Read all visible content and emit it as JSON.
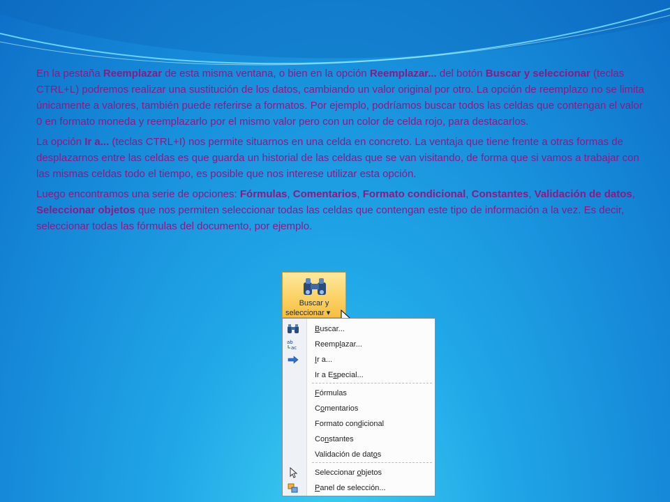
{
  "paragraphs": [
    [
      {
        "t": "En la pestaña ",
        "b": false
      },
      {
        "t": "Reemplazar",
        "b": true
      },
      {
        "t": " de esta misma ventana, o bien en la opción ",
        "b": false
      },
      {
        "t": "Reemplazar...",
        "b": true
      },
      {
        "t": " del botón ",
        "b": false
      },
      {
        "t": "Buscar y seleccionar",
        "b": true
      },
      {
        "t": " (teclas CTRL+L) podremos realizar una sustitución de los datos, cambiando un valor original por otro. La opción de reemplazo no se limita únicamente a valores, también puede referirse a formatos. Por ejemplo, podríamos buscar todos las celdas que contengan el valor 0 en formato moneda y reemplazarlo por el mismo valor pero con un color de celda rojo, para destacarlos.",
        "b": false
      }
    ],
    [
      {
        "t": " La opción ",
        "b": false
      },
      {
        "t": "Ir a...",
        "b": true
      },
      {
        "t": " (teclas CTRL+I) nos permite situarnos en una celda en concreto. La ventaja que tiene frente a otras formas de desplazarnos entre las celdas es que guarda un historial de las celdas que se van visitando, de forma que si vamos a trabajar con las mismas celdas todo el tiempo, es posible que nos interese utilizar esta opción.",
        "b": false
      }
    ],
    [
      {
        "t": " Luego encontramos una serie de opciones: ",
        "b": false
      },
      {
        "t": "Fórmulas",
        "b": true
      },
      {
        "t": ", ",
        "b": false
      },
      {
        "t": "Comentarios",
        "b": true
      },
      {
        "t": ", ",
        "b": false
      },
      {
        "t": "Formato condicional",
        "b": true
      },
      {
        "t": ", ",
        "b": false
      },
      {
        "t": "Constantes",
        "b": true
      },
      {
        "t": ", ",
        "b": false
      },
      {
        "t": "Validación de datos",
        "b": true
      },
      {
        "t": ", ",
        "b": false
      },
      {
        "t": "Seleccionar objetos",
        "b": true
      },
      {
        "t": " que nos permiten seleccionar todas las celdas que contengan este tipo de información a la vez. Es decir, seleccionar todas las fórmulas del documento, por ejemplo.",
        "b": false
      }
    ]
  ],
  "ribbon_button": {
    "line1": "Buscar y",
    "line2": "seleccionar",
    "icon": "binoculars-icon"
  },
  "menu": {
    "items": [
      {
        "pre": "",
        "u": "B",
        "post": "uscar...",
        "icon": "binoculars-icon",
        "name": "menu-item-buscar"
      },
      {
        "pre": "Reemp",
        "u": "l",
        "post": "azar...",
        "icon": "replace-icon",
        "name": "menu-item-reemplazar"
      },
      {
        "pre": "",
        "u": "I",
        "post": "r a...",
        "icon": "arrow-right-icon",
        "name": "menu-item-ir-a"
      },
      {
        "pre": "Ir a E",
        "u": "s",
        "post": "pecial...",
        "icon": "",
        "name": "menu-item-ir-a-especial"
      },
      {
        "pre": "",
        "u": "F",
        "post": "órmulas",
        "icon": "",
        "name": "menu-item-formulas"
      },
      {
        "pre": "C",
        "u": "o",
        "post": "mentarios",
        "icon": "",
        "name": "menu-item-comentarios"
      },
      {
        "pre": "Formato con",
        "u": "d",
        "post": "icional",
        "icon": "",
        "name": "menu-item-formato-condicional"
      },
      {
        "pre": "Co",
        "u": "n",
        "post": "stantes",
        "icon": "",
        "name": "menu-item-constantes"
      },
      {
        "pre": "Validación de dat",
        "u": "o",
        "post": "s",
        "icon": "",
        "name": "menu-item-validacion"
      },
      {
        "pre": "Seleccionar ",
        "u": "o",
        "post": "bjetos",
        "icon": "pointer-icon",
        "name": "menu-item-seleccionar-objetos"
      },
      {
        "pre": "",
        "u": "P",
        "post": "anel de selección...",
        "icon": "selection-pane-icon",
        "name": "menu-item-panel-seleccion"
      }
    ]
  },
  "colors": {
    "text": "#8b1a86",
    "accent": "#fbd46a"
  }
}
